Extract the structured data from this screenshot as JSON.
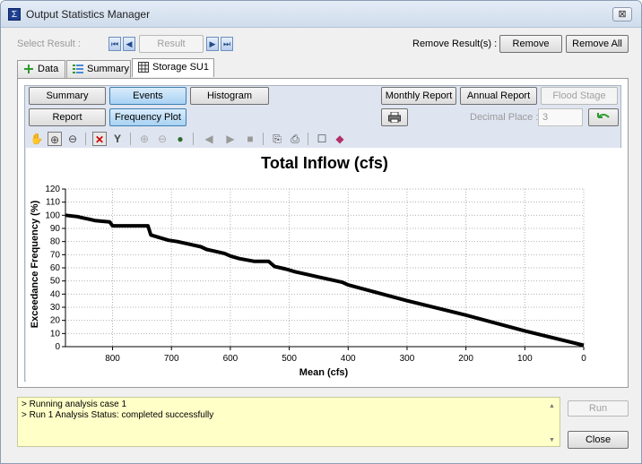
{
  "window": {
    "title": "Output Statistics Manager",
    "close_label": "⊠"
  },
  "result_bar": {
    "select_label": "Select Result :",
    "result_button": "Result",
    "remove_label": "Remove Result(s) :",
    "remove_button": "Remove",
    "remove_all_button": "Remove All"
  },
  "tabs": [
    {
      "label": "Data"
    },
    {
      "label": "Summary"
    },
    {
      "label": "Storage SU1"
    }
  ],
  "buttons": {
    "summary": "Summary",
    "events": "Events",
    "histogram": "Histogram",
    "report": "Report",
    "frequency_plot": "Frequency Plot",
    "monthly_report": "Monthly Report",
    "annual_report": "Annual Report",
    "flood_stage": "Flood Stage",
    "decimal_place_label": "Decimal Place :",
    "decimal_place_value": "3"
  },
  "toolbar_icons": [
    "pan-icon",
    "zoom-in-box-icon",
    "zoom-out-box-icon",
    "x-cursor-icon",
    "y-cursor-icon",
    "zoom-in-icon",
    "zoom-out-icon",
    "globe-icon",
    "first-icon",
    "play-icon",
    "stop-icon",
    "copy-icon",
    "print-icon",
    "properties-icon",
    "eraser-icon"
  ],
  "chart_data": {
    "type": "line",
    "title": "Total Inflow (cfs)",
    "xlabel": "Mean (cfs)",
    "ylabel": "Exceedance Frequency (%)",
    "xlim": [
      880,
      0
    ],
    "ylim": [
      0,
      120
    ],
    "x_ticks": [
      800,
      700,
      600,
      500,
      400,
      300,
      200,
      100,
      0
    ],
    "y_ticks": [
      0,
      10,
      20,
      30,
      40,
      50,
      60,
      70,
      80,
      90,
      100,
      110,
      120
    ],
    "grid": true,
    "series": [
      {
        "color": "#000000",
        "x": [
          880,
          860,
          850,
          840,
          830,
          805,
          800,
          740,
          735,
          720,
          705,
          690,
          670,
          650,
          640,
          630,
          610,
          600,
          585,
          560,
          535,
          525,
          505,
          490,
          470,
          450,
          430,
          410,
          400,
          300,
          200,
          100,
          0
        ],
        "y": [
          100,
          99,
          98,
          97,
          96,
          95,
          92,
          92,
          85,
          83,
          81,
          80,
          78,
          76,
          74,
          73,
          71,
          69,
          67,
          65,
          65,
          61,
          59,
          57,
          55,
          53,
          51,
          49,
          47,
          35,
          24,
          12,
          1
        ]
      }
    ]
  },
  "log": [
    "> Running analysis case 1",
    "> Run 1 Analysis Status: completed successfully"
  ],
  "footer": {
    "run_button": "Run",
    "close_button": "Close"
  }
}
